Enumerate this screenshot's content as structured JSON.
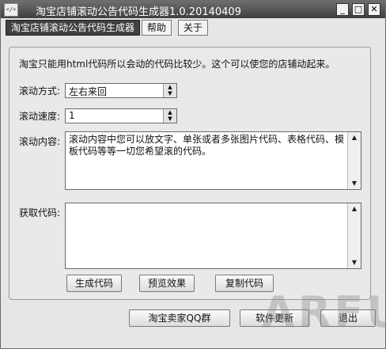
{
  "titlebar": {
    "app_icon_text": "</>",
    "title": "淘宝店铺滚动公告代码生成器1.0.20140409",
    "minimize": "_",
    "maximize": "□",
    "close": "✕"
  },
  "menu": {
    "items": [
      {
        "label": "淘宝店铺滚动公告代码生成器"
      },
      {
        "label": "帮助"
      },
      {
        "label": "关于"
      }
    ]
  },
  "panel": {
    "description": "淘宝只能用html代码所以会动的代码比较少。这个可以使您的店铺动起来。",
    "scroll_mode_label": "滚动方式:",
    "scroll_mode_value": "左右来回",
    "scroll_speed_label": "滚动速度:",
    "scroll_speed_value": "1",
    "content_label": "滚动内容:",
    "content_value": "滚动内容中您可以放文字、单张或者多张图片代码、表格代码、模板代码等等一切您希望滚的代码。",
    "get_code_label": "获取代码:",
    "get_code_value": "",
    "generate_button": "生成代码",
    "preview_button": "预览效果",
    "copy_button": "复制代码"
  },
  "footer": {
    "qq_group_button": "淘宝卖家QQ群",
    "update_button": "软件更新",
    "exit_button": "退出"
  },
  "watermark": "ARFUN"
}
